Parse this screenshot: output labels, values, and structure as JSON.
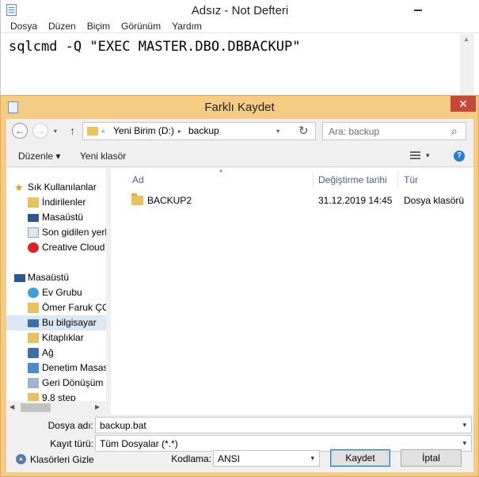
{
  "notepad": {
    "title": "Adsız - Not Defteri",
    "menu": [
      "Dosya",
      "Düzen",
      "Biçim",
      "Görünüm",
      "Yardım"
    ],
    "content": "sqlcmd -Q \"EXEC MASTER.DBO.DBBACKUP\""
  },
  "dialog": {
    "title": "Farklı Kaydet",
    "close": "✕",
    "address": {
      "chevron": "«",
      "parts": [
        "Yeni Birim (D:)",
        "backup"
      ],
      "sep": "▸"
    },
    "search_placeholder": "Ara: backup",
    "toolbar": {
      "organize": "Düzenle ▾",
      "new_folder": "Yeni klasör"
    },
    "nav_pane": {
      "items": [
        {
          "label": "Sık Kullanılanlar",
          "icon": "star-icon"
        },
        {
          "label": "İndirilenler",
          "icon": "downloads-icon"
        },
        {
          "label": "Masaüstü",
          "icon": "desktop-icon"
        },
        {
          "label": "Son gidilen yerler",
          "icon": "recent-icon"
        },
        {
          "label": "Creative Cloud Fi",
          "icon": "creative-cloud-icon"
        },
        {
          "label": "Masaüstü",
          "icon": "desktop-icon"
        },
        {
          "label": "Ev Grubu",
          "icon": "homegroup-icon"
        },
        {
          "label": "Ömer Faruk ÇOL",
          "icon": "user-icon"
        },
        {
          "label": "Bu bilgisayar",
          "icon": "computer-icon"
        },
        {
          "label": "Kitaplıklar",
          "icon": "libraries-icon"
        },
        {
          "label": "Ağ",
          "icon": "network-icon"
        },
        {
          "label": "Denetim Masası",
          "icon": "control-panel-icon"
        },
        {
          "label": "Geri Dönüşüm Ku",
          "icon": "recycle-bin-icon"
        },
        {
          "label": "9.8 step",
          "icon": "folder-icon"
        }
      ]
    },
    "columns": [
      "Ad",
      "Değiştirme tarihi",
      "Tür"
    ],
    "rows": [
      {
        "name": "BACKUP2",
        "date": "31.12.2019 14:45",
        "type": "Dosya klasörü"
      }
    ],
    "filename_label": "Dosya adı:",
    "filename_value": "backup.bat",
    "filetype_label": "Kayıt türü:",
    "filetype_value": "Tüm Dosyalar  (*.*)",
    "hide_folders": "Klasörleri Gizle",
    "encoding_label": "Kodlama:",
    "encoding_value": "ANSI",
    "save_button": "Kaydet",
    "cancel_button": "İptal",
    "colors": {
      "accent": "#f5cc84",
      "close": "#c7483a",
      "folder": "#e8c25f"
    }
  }
}
